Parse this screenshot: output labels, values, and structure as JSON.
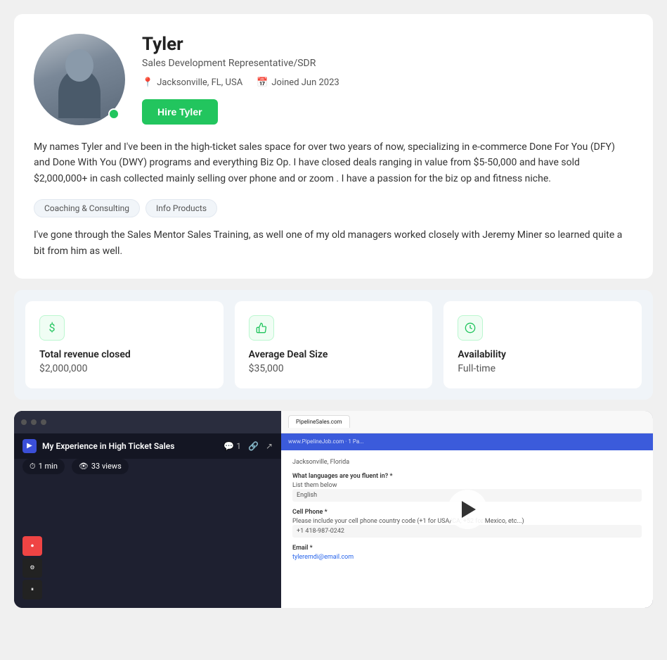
{
  "profile": {
    "name": "Tyler",
    "title": "Sales Development Representative/SDR",
    "location": "Jacksonville, FL, USA",
    "joined": "Joined Jun 2023",
    "hire_button": "Hire Tyler",
    "bio": "My names Tyler and I've been in the high-ticket sales space for over two years of now, specializing in e-commerce Done For You (DFY) and Done With You (DWY) programs and everything Biz Op. I have closed deals ranging in value from $5-50,000 and have sold $2,000,000+ in cash collected mainly selling over phone and or zoom . I have a passion for the biz op and fitness niche.",
    "training": "I've gone through the Sales Mentor Sales Training, as well one of my old managers worked closely with Jeremy Miner so learned quite a bit from him as well.",
    "tags": [
      "Coaching & Consulting",
      "Info Products"
    ]
  },
  "stats": [
    {
      "label": "Total revenue closed",
      "value": "$2,000,000",
      "icon": "$"
    },
    {
      "label": "Average Deal Size",
      "value": "$35,000",
      "icon": "👍"
    },
    {
      "label": "Availability",
      "value": "Full-time",
      "icon": "🕐"
    }
  ],
  "video": {
    "title": "My Experience in High Ticket Sales",
    "duration": "1 min",
    "views": "33 views",
    "browser_url": "www.PipelineJob.com · 1 Pa...",
    "comment_count": "1",
    "form_fields": [
      {
        "label": "Jacksonville, Florida"
      },
      {
        "label": "What languages are you fluent in? *",
        "sublabel": "List them below",
        "value": "English"
      },
      {
        "label": "Cell Phone *",
        "sublabel": "Please include your cell phone country code (+1 for USA/CA, +52 for Mexico, etc...)",
        "value": "+1 418-987-0242"
      },
      {
        "label": "Email *",
        "value": "tyleremdi@email.com"
      }
    ]
  },
  "icons": {
    "location": "📍",
    "calendar": "📅",
    "clock": "⏰",
    "thumbsup": "👍",
    "dollar": "$",
    "comment": "💬",
    "link": "🔗",
    "share": "↗",
    "eye": "👁",
    "play": "▶"
  }
}
